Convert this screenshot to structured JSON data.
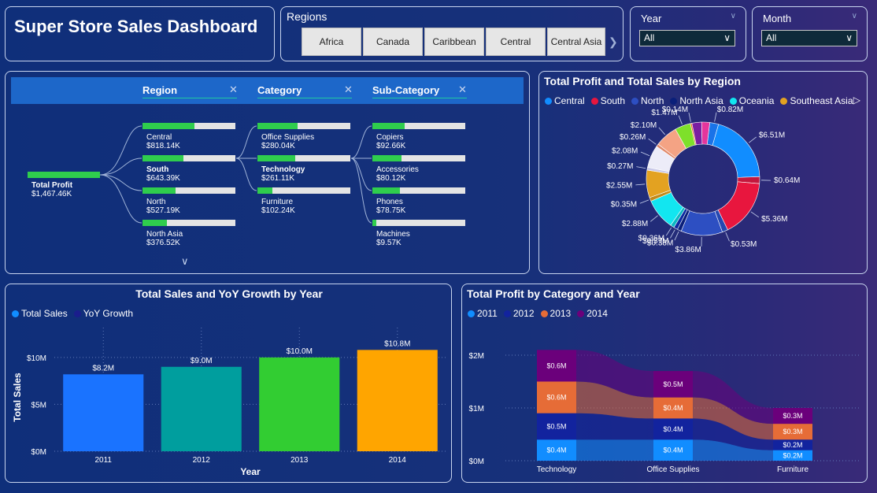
{
  "header": {
    "title": "Super Store Sales Dashboard"
  },
  "regions_slicer": {
    "label": "Regions",
    "options": [
      "Africa",
      "Canada",
      "Caribbean",
      "Central",
      "Central Asia"
    ]
  },
  "year_filter": {
    "label": "Year",
    "value": "All"
  },
  "month_filter": {
    "label": "Month",
    "value": "All"
  },
  "decomposition_tree": {
    "levels": [
      "Region",
      "Category",
      "Sub-Category"
    ],
    "root": {
      "label": "Total Profit",
      "value": "$1,467.46K",
      "fraction": 1.0
    },
    "regions": [
      {
        "name": "Central",
        "value": "$818.14K",
        "fraction": 0.56,
        "bold": false
      },
      {
        "name": "South",
        "value": "$643.39K",
        "fraction": 0.44,
        "bold": true
      },
      {
        "name": "North",
        "value": "$527.19K",
        "fraction": 0.36,
        "bold": false
      },
      {
        "name": "North Asia",
        "value": "$376.52K",
        "fraction": 0.26,
        "bold": false
      }
    ],
    "categories": [
      {
        "name": "Office Supplies",
        "value": "$280.04K",
        "fraction": 0.43,
        "bold": false
      },
      {
        "name": "Technology",
        "value": "$261.11K",
        "fraction": 0.41,
        "bold": true
      },
      {
        "name": "Furniture",
        "value": "$102.24K",
        "fraction": 0.16,
        "bold": false
      }
    ],
    "subcategories": [
      {
        "name": "Copiers",
        "value": "$92.66K",
        "fraction": 0.35
      },
      {
        "name": "Accessories",
        "value": "$80.12K",
        "fraction": 0.31
      },
      {
        "name": "Phones",
        "value": "$78.75K",
        "fraction": 0.3
      },
      {
        "name": "Machines",
        "value": "$9.57K",
        "fraction": 0.04
      }
    ]
  },
  "donut": {
    "title": "Total Profit and Total Sales by Region",
    "legend": [
      {
        "name": "Central",
        "color": "#118dff"
      },
      {
        "name": "South",
        "color": "#e8163e"
      },
      {
        "name": "North",
        "color": "#2d4fc2"
      },
      {
        "name": "North Asia",
        "color": "#0a1f7a"
      },
      {
        "name": "Oceania",
        "color": "#12e6f0"
      },
      {
        "name": "Southeast Asia",
        "color": "#e3a221"
      }
    ]
  },
  "sales_chart": {
    "title": "Total Sales and YoY Growth by Year",
    "legend": [
      "Total Sales",
      "YoY Growth"
    ],
    "legend_colors": [
      "#118dff",
      "#1a1d8c"
    ]
  },
  "profit_chart": {
    "title": "Total Profit by Category and Year",
    "legend": [
      "2011",
      "2012",
      "2013",
      "2014"
    ],
    "legend_colors": [
      "#118dff",
      "#12239e",
      "#e66c37",
      "#6b007b"
    ]
  },
  "chart_data": [
    {
      "type": "pie",
      "title": "Total Profit and Total Sales by Region",
      "slices": [
        {
          "label": "$0.82M",
          "value": 0.82,
          "color": "#1a73e8"
        },
        {
          "label": "$6.51M",
          "value": 6.51,
          "color": "#118dff"
        },
        {
          "label": "$0.64M",
          "value": 0.64,
          "color": "#c4173d"
        },
        {
          "label": "$5.36M",
          "value": 5.36,
          "color": "#e8163e"
        },
        {
          "label": "$0.53M",
          "value": 0.53,
          "color": "#2447b0"
        },
        {
          "label": "$3.86M",
          "value": 3.86,
          "color": "#2d4fc2"
        },
        {
          "label": "$0.38M",
          "value": 0.38,
          "color": "#0a1f7a"
        },
        {
          "label": "$0.37M",
          "value": 0.37,
          "color": "#0d2aa0"
        },
        {
          "label": "$0.36M",
          "value": 0.36,
          "color": "#0bb8c4"
        },
        {
          "label": "$2.88M",
          "value": 2.88,
          "color": "#12e6f0"
        },
        {
          "label": "$0.35M",
          "value": 0.35,
          "color": "#c28a1a"
        },
        {
          "label": "$2.55M",
          "value": 2.55,
          "color": "#e3a221"
        },
        {
          "label": "$0.27M",
          "value": 0.27,
          "color": "#c9c9e8"
        },
        {
          "label": "$2.08M",
          "value": 2.08,
          "color": "#ececf8"
        },
        {
          "label": "$0.26M",
          "value": 0.26,
          "color": "#e0896a"
        },
        {
          "label": "$2.10M",
          "value": 2.1,
          "color": "#f4a384"
        },
        {
          "label": "$1.47M",
          "value": 1.47,
          "color": "#7ee02a"
        },
        {
          "label": "$0.14M",
          "value": 0.14,
          "color": "#e96a1f"
        },
        {
          "label": "",
          "value": 0.9,
          "color": "#7a1fa2"
        },
        {
          "label": "",
          "value": 0.75,
          "color": "#e5359c"
        }
      ]
    },
    {
      "type": "bar",
      "title": "Total Sales and YoY Growth by Year",
      "categories": [
        "2011",
        "2012",
        "2013",
        "2014"
      ],
      "values": [
        8.2,
        9.0,
        10.0,
        10.8
      ],
      "labels": [
        "$8.2M",
        "$9.0M",
        "$10.0M",
        "$10.8M"
      ],
      "colors": [
        "#1a73ff",
        "#009e9e",
        "#32cd32",
        "#ffa500"
      ],
      "xlabel": "Year",
      "ylabel": "Total Sales",
      "yticks": [
        "$0M",
        "$5M",
        "$10M"
      ],
      "ylim": [
        0,
        11.5
      ]
    },
    {
      "type": "area",
      "title": "Total Profit by Category and Year",
      "categories": [
        "Technology",
        "Office Supplies",
        "Furniture"
      ],
      "yticks": [
        "$0M",
        "$1M",
        "$2M"
      ],
      "ylim": [
        0,
        2
      ],
      "series": [
        {
          "name": "2011",
          "values": [
            0.4,
            0.4,
            0.2
          ],
          "labels": [
            "$0.4M",
            "$0.4M",
            "$0.2M"
          ],
          "color": "#118dff"
        },
        {
          "name": "2012",
          "values": [
            0.5,
            0.4,
            0.2
          ],
          "labels": [
            "$0.5M",
            "$0.4M",
            "$0.2M"
          ],
          "color": "#12239e"
        },
        {
          "name": "2013",
          "values": [
            0.6,
            0.4,
            0.3
          ],
          "labels": [
            "$0.6M",
            "$0.4M",
            "$0.3M"
          ],
          "color": "#e66c37"
        },
        {
          "name": "2014",
          "values": [
            0.6,
            0.5,
            0.3
          ],
          "labels": [
            "$0.6M",
            "$0.5M",
            "$0.3M"
          ],
          "color": "#6b007b"
        }
      ]
    }
  ]
}
